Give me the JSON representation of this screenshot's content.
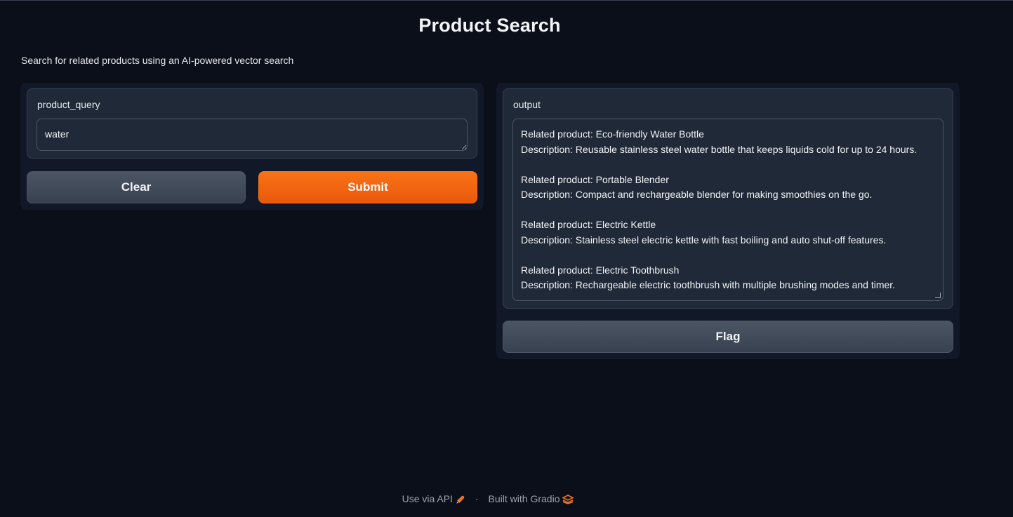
{
  "app": {
    "title": "Product Search",
    "description": "Search for related products using an AI-powered vector search"
  },
  "inputs": {
    "query_label": "product_query",
    "query_value": "water"
  },
  "buttons": {
    "clear": "Clear",
    "submit": "Submit",
    "flag": "Flag"
  },
  "output": {
    "label": "output",
    "results": [
      {
        "product": "Related product: Eco-friendly Water Bottle",
        "description": "Description: Reusable stainless steel water bottle that keeps liquids cold for up to 24 hours."
      },
      {
        "product": "Related product: Portable Blender",
        "description": "Description: Compact and rechargeable blender for making smoothies on the go."
      },
      {
        "product": "Related product: Electric Kettle",
        "description": "Description: Stainless steel electric kettle with fast boiling and auto shut-off features."
      },
      {
        "product": "Related product: Electric Toothbrush",
        "description": "Description: Rechargeable electric toothbrush with multiple brushing modes and timer."
      }
    ]
  },
  "footer": {
    "api_link": "Use via API",
    "separator": "·",
    "built_with": "Built with Gradio",
    "api_icon": "rocket-icon",
    "gradio_icon": "gradio-logo-icon"
  },
  "colors": {
    "background": "#0b0f19",
    "panel": "#111827",
    "block": "#1f2937",
    "accent": "#f97316"
  }
}
